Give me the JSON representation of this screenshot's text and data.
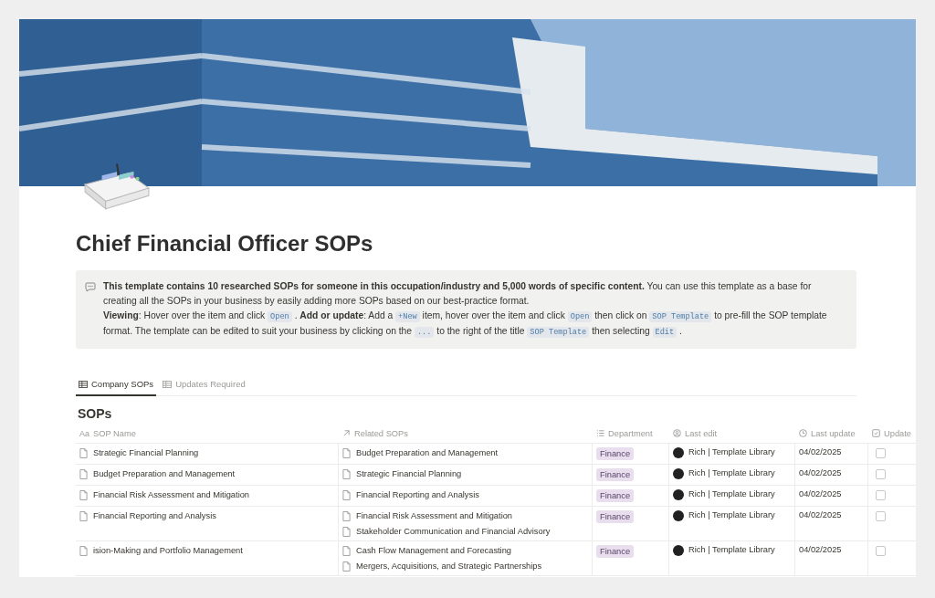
{
  "page": {
    "title": "Chief Financial Officer SOPs"
  },
  "callout": {
    "paragraphs": [
      [
        {
          "kind": "text",
          "text": "**This template contains 10 researched SOPs for someone in this occupation/industry and 5,000 words of specific content.** You can use this template as a base for creating all the SOPs in your business by easily adding more SOPs based on our best-practice format."
        }
      ],
      [
        {
          "kind": "text",
          "text": "**Viewing**: Hover over the item and click"
        },
        {
          "kind": "code",
          "text": "Open"
        },
        {
          "kind": "text",
          "text": ". **Add or update**: Add a"
        },
        {
          "kind": "code",
          "text": "+New"
        },
        {
          "kind": "text",
          "text": "item, hover over the item and click"
        },
        {
          "kind": "code",
          "text": "Open"
        },
        {
          "kind": "text",
          "text": "then click on"
        },
        {
          "kind": "code",
          "text": "SOP Template"
        },
        {
          "kind": "text",
          "text": "to pre-fill the SOP template format. The template can be edited to suit your business by clicking on the"
        },
        {
          "kind": "code",
          "text": "..."
        },
        {
          "kind": "text",
          "text": "to the right of the title"
        },
        {
          "kind": "code",
          "text": "SOP Template"
        },
        {
          "kind": "text",
          "text": "then selecting"
        },
        {
          "kind": "code",
          "text": "Edit"
        },
        {
          "kind": "text",
          "text": "."
        }
      ]
    ]
  },
  "tabs": [
    {
      "label": "Company SOPs",
      "selected": true
    },
    {
      "label": "Updates Required",
      "selected": false
    }
  ],
  "table": {
    "title": "SOPs",
    "columns": [
      {
        "label": "SOP Name",
        "kind": "title",
        "icon": "Aa"
      },
      {
        "label": "Related SOPs",
        "kind": "relation"
      },
      {
        "label": "Department",
        "kind": "select"
      },
      {
        "label": "Last edit",
        "kind": "person"
      },
      {
        "label": "Last update",
        "kind": "date"
      },
      {
        "label": "Update",
        "kind": "checkbox"
      }
    ],
    "rows": [
      {
        "name": "Strategic Financial Planning",
        "related": [
          "Budget Preparation and Management"
        ],
        "department": "Finance",
        "last_edit": "Rich | Template Library",
        "last_update": "04/02/2025",
        "update": false
      },
      {
        "name": "Budget Preparation and Management",
        "related": [
          "Strategic Financial Planning"
        ],
        "department": "Finance",
        "last_edit": "Rich | Template Library",
        "last_update": "04/02/2025",
        "update": false
      },
      {
        "name": "Financial Risk Assessment and Mitigation",
        "related": [
          "Financial Reporting and Analysis"
        ],
        "department": "Finance",
        "last_edit": "Rich | Template Library",
        "last_update": "04/02/2025",
        "update": false
      },
      {
        "name": "Financial Reporting and Analysis",
        "related": [
          "Financial Risk Assessment and Mitigation",
          "Stakeholder Communication and Financial Advisory"
        ],
        "department": "Finance",
        "last_edit": "Rich | Template Library",
        "last_update": "04/02/2025",
        "update": false
      },
      {
        "name": "ision-Making and Portfolio Management",
        "related": [
          "Cash Flow Management and Forecasting",
          "Mergers, Acquisitions, and Strategic Partnerships"
        ],
        "department": "Finance",
        "last_edit": "Rich | Template Library",
        "last_update": "04/02/2025",
        "update": false
      }
    ]
  }
}
